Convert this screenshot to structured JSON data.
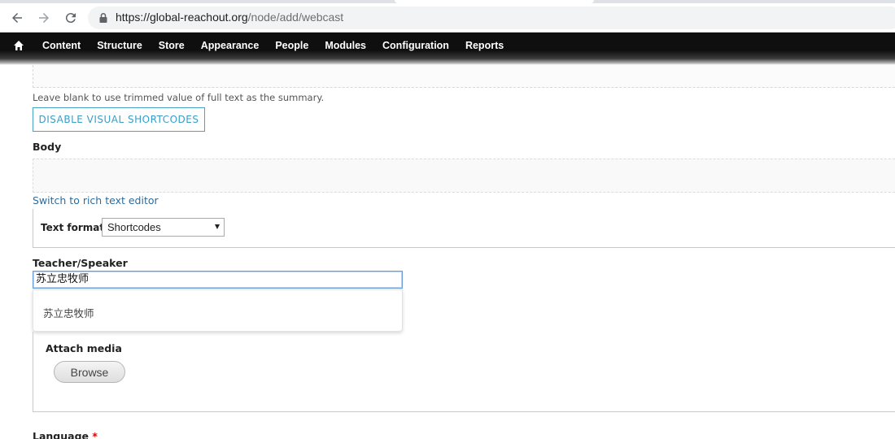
{
  "browser": {
    "url_host": "https://global-reachout.org",
    "url_path": "/node/add/webcast"
  },
  "toolbar": {
    "items": [
      {
        "label": "Content"
      },
      {
        "label": "Structure"
      },
      {
        "label": "Store"
      },
      {
        "label": "Appearance"
      },
      {
        "label": "People"
      },
      {
        "label": "Modules"
      },
      {
        "label": "Configuration"
      },
      {
        "label": "Reports"
      }
    ]
  },
  "form": {
    "summary_description": "Leave blank to use trimmed value of full text as the summary.",
    "shortcodes_button": "DISABLE VISUAL SHORTCODES",
    "body_label": "Body",
    "rich_text_link": "Switch to rich text editor",
    "text_format_label": "Text format",
    "text_format_value": "Shortcodes",
    "teacher_label": "Teacher/Speaker",
    "teacher_value": "苏立忠牧师",
    "autocomplete_suggestion": "苏立忠牧师",
    "attach_media_label": "Attach media",
    "browse_button": "Browse",
    "language_label": "Language",
    "required_marker": "*"
  },
  "colors": {
    "toolbar_bg": "#0f0f0f",
    "link": "#2f6b9a",
    "accent_button": "#3a9dc6",
    "required": "#ee0000"
  }
}
